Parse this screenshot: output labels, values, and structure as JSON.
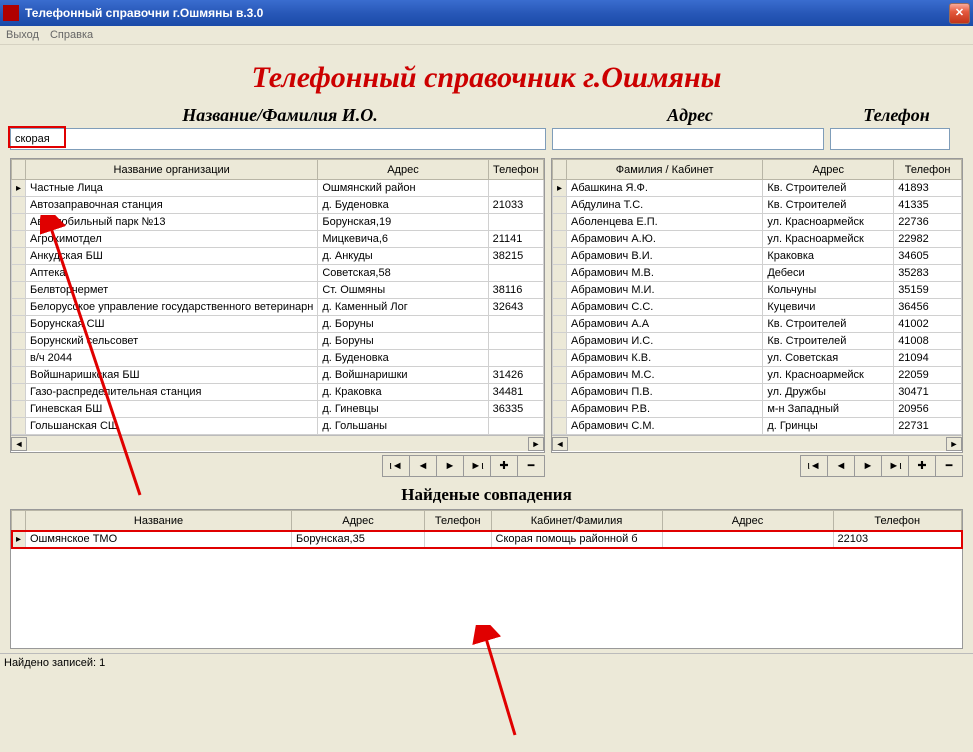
{
  "window": {
    "title": "Телефонный справочни г.Ошмяны в.3.0"
  },
  "menu": {
    "exit": "Выход",
    "help": "Справка"
  },
  "header": {
    "big_title": "Телефонный справочник г.Ошмяны",
    "label_name": "Название/Фамилия И.О.",
    "label_addr": "Адрес",
    "label_phone": "Телефон"
  },
  "search": {
    "name_value": "скорая",
    "addr_value": "",
    "phone_value": ""
  },
  "left_table": {
    "cols": {
      "name": "Название организации",
      "addr": "Адрес",
      "phone": "Телефон"
    },
    "rows": [
      {
        "name": "Частные Лица",
        "addr": "Ошмянский район",
        "phone": ""
      },
      {
        "name": "Автозаправочная станция",
        "addr": "д. Буденовка",
        "phone": "21033"
      },
      {
        "name": "Автомобильный парк №13",
        "addr": "Борунская,19",
        "phone": ""
      },
      {
        "name": "Агрохимотдел",
        "addr": "Мицкевича,6",
        "phone": "21141"
      },
      {
        "name": "Анкудская БШ",
        "addr": "д. Анкуды",
        "phone": "38215"
      },
      {
        "name": "Аптека",
        "addr": "Советская,58",
        "phone": ""
      },
      {
        "name": "Белвторчермет",
        "addr": "Ст. Ошмяны",
        "phone": "38116"
      },
      {
        "name": "Белорусское управление государственного ветеринарн",
        "addr": "д. Каменный Лог",
        "phone": "32643"
      },
      {
        "name": "Борунская СШ",
        "addr": "д. Боруны",
        "phone": ""
      },
      {
        "name": "Борунский сельсовет",
        "addr": "д. Боруны",
        "phone": ""
      },
      {
        "name": "в/ч 2044",
        "addr": "д. Буденовка",
        "phone": ""
      },
      {
        "name": "Войшнаришкская БШ",
        "addr": "д. Войшнаришки",
        "phone": "31426"
      },
      {
        "name": "Газо-распределительная станция",
        "addr": "д. Краковка",
        "phone": "34481"
      },
      {
        "name": "Гиневская БШ",
        "addr": "д. Гиневцы",
        "phone": "36335"
      },
      {
        "name": "Гольшанская СШ",
        "addr": "д. Гольшаны",
        "phone": ""
      }
    ]
  },
  "right_table": {
    "cols": {
      "name": "Фамилия / Кабинет",
      "addr": "Адрес",
      "phone": "Телефон"
    },
    "rows": [
      {
        "name": "Абашкина Я.Ф.",
        "addr": "Кв. Строителей",
        "phone": "41893"
      },
      {
        "name": "Абдулина Т.С.",
        "addr": "Кв. Строителей",
        "phone": "41335"
      },
      {
        "name": "Аболенцева Е.П.",
        "addr": "ул. Красноармейск",
        "phone": "22736"
      },
      {
        "name": "Абрамович  А.Ю.",
        "addr": "ул. Красноармейск",
        "phone": "22982"
      },
      {
        "name": "Абрамович  В.И.",
        "addr": "Краковка",
        "phone": "34605"
      },
      {
        "name": "Абрамович  М.В.",
        "addr": "Дебеси",
        "phone": "35283"
      },
      {
        "name": "Абрамович  М.И.",
        "addr": "Кольчуны",
        "phone": "35159"
      },
      {
        "name": "Абрамович  С.С.",
        "addr": "Куцевичи",
        "phone": "36456"
      },
      {
        "name": "Абрамович А.А",
        "addr": "Кв. Строителей",
        "phone": "41002"
      },
      {
        "name": "Абрамович И.С.",
        "addr": "Кв. Строителей",
        "phone": "41008"
      },
      {
        "name": "Абрамович К.В.",
        "addr": "ул. Советская",
        "phone": "21094"
      },
      {
        "name": "Абрамович М.С.",
        "addr": "ул. Красноармейск",
        "phone": "22059"
      },
      {
        "name": "Абрамович П.В.",
        "addr": "ул. Дружбы",
        "phone": "30471"
      },
      {
        "name": "Абрамович Р.В.",
        "addr": "м-н Западный",
        "phone": "20956"
      },
      {
        "name": "Абрамович С.М.",
        "addr": "д. Гринцы",
        "phone": "22731"
      }
    ]
  },
  "nav": {
    "first": "⏮",
    "prev": "◄",
    "next": "►",
    "last": "⏭",
    "add": "✚",
    "del": "━"
  },
  "results": {
    "title": "Найденые совпадения",
    "cols": {
      "name": "Название",
      "addr": "Адрес",
      "phone": "Телефон",
      "cab": "Кабинет/Фамилия",
      "addr2": "Адрес",
      "phone2": "Телефон"
    },
    "row": {
      "name": "Ошмянское ТМО",
      "addr": "Борунская,35",
      "phone": "",
      "cab": "Скорая помощь районной б",
      "addr2": "",
      "phone2": "22103"
    }
  },
  "status": {
    "text": "Найдено записей: 1"
  }
}
